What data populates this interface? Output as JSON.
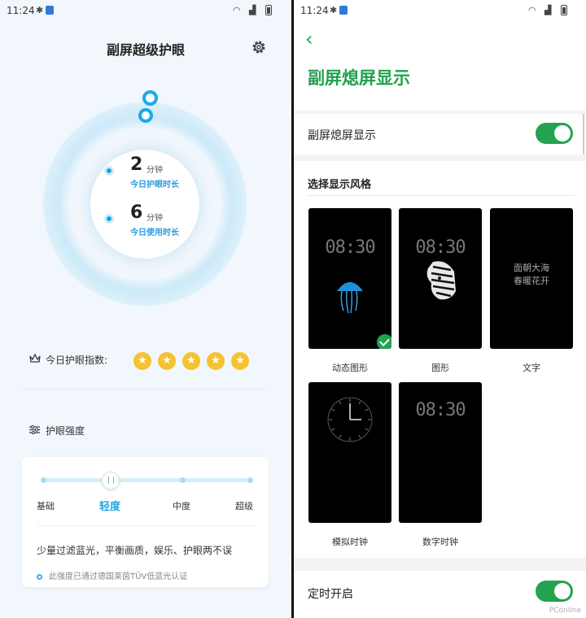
{
  "status": {
    "time": "11:24"
  },
  "left": {
    "title": "副屏超级护眼",
    "today_protect": {
      "value": "2",
      "unit": "分钟",
      "label": "今日护眼时长"
    },
    "today_use": {
      "value": "6",
      "unit": "分钟",
      "label": "今日使用时长"
    },
    "index_label": "今日护眼指数:",
    "rating": 5,
    "star_glyph": "★",
    "strength_title": "护眼强度",
    "levels": [
      "基础",
      "轻度",
      "中度",
      "超级"
    ],
    "selected_level": "轻度",
    "description": "少量过滤蓝光，平衡画质，娱乐、护眼两不误",
    "certification": "此强度已通过德国莱茵TÜV低蓝光认证"
  },
  "right": {
    "back_glyph": "‹",
    "title": "副屏熄屏显示",
    "toggle_row": {
      "label": "副屏熄屏显示",
      "on": true
    },
    "section_title": "选择显示风格",
    "styles": [
      {
        "label": "动态图形",
        "clock": "08:30",
        "selected": true
      },
      {
        "label": "图形",
        "clock": "08:30",
        "selected": false
      },
      {
        "label": "文字",
        "poem": [
          "面朝大海",
          "春暖花开"
        ],
        "selected": false
      },
      {
        "label": "模拟时钟",
        "selected": false
      },
      {
        "label": "数字时钟",
        "clock": "08:30",
        "selected": false
      }
    ],
    "timer_row": {
      "label": "定时开启",
      "on": true
    },
    "watermark": "PConline"
  },
  "colors": {
    "accent_green": "#23a24f",
    "accent_blue": "#1aa3e0",
    "star": "#f5c230"
  }
}
